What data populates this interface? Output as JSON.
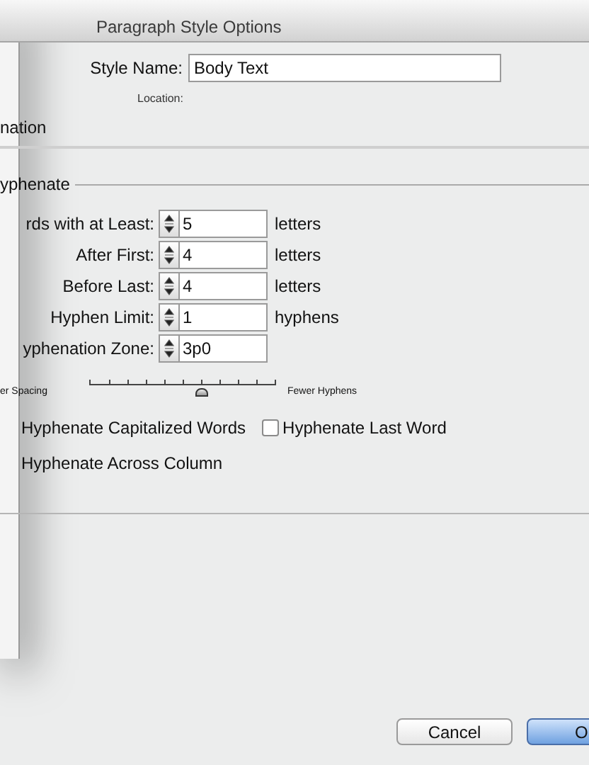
{
  "window": {
    "title": "Paragraph Style Options"
  },
  "style_name": {
    "label": "Style Name:",
    "value": "Body Text"
  },
  "location_label": "Location:",
  "section_title": "nation",
  "group": {
    "title": "yphenate",
    "fields": [
      {
        "label": "rds with at Least:",
        "value": "5",
        "unit": "letters"
      },
      {
        "label": "After First:",
        "value": "4",
        "unit": "letters"
      },
      {
        "label": "Before Last:",
        "value": "4",
        "unit": "letters"
      },
      {
        "label": "Hyphen Limit:",
        "value": "1",
        "unit": "hyphens"
      },
      {
        "label": "yphenation Zone:",
        "value": "3p0"
      }
    ],
    "slider": {
      "left_label": "er Spacing",
      "right_label": "Fewer Hyphens",
      "level": 0.6
    },
    "options": [
      {
        "label": "Hyphenate Capitalized Words"
      },
      {
        "label": "Hyphenate Last Word",
        "checked": false
      },
      {
        "label": "Hyphenate Across Column"
      }
    ]
  },
  "buttons": [
    {
      "label": "Cancel",
      "default": false
    },
    {
      "label": "O",
      "default": true
    }
  ]
}
